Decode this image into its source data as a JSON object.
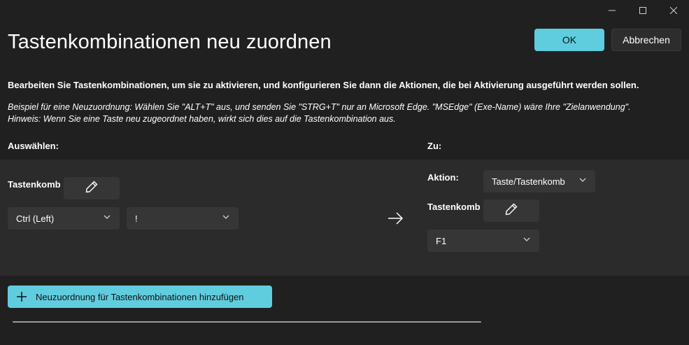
{
  "window": {
    "title": "Tastenkombinationen neu zuordnen",
    "controls": [
      "minimize-icon",
      "maximize-icon",
      "close-icon"
    ]
  },
  "header": {
    "ok_label": "OK",
    "cancel_label": "Abbrechen"
  },
  "description": "Bearbeiten Sie Tastenkombinationen, um sie zu aktivieren, und konfigurieren Sie dann die Aktionen, die bei Aktivierung ausgeführt werden sollen.",
  "example_line1": "Beispiel für eine Neuzuordnung: Wählen Sie \"ALT+T\" aus, und senden Sie \"STRG+T\" nur an Microsoft Edge. \"MSEdge\" (Exe-Name) wäre Ihre \"Zielanwendung\".",
  "example_line2": "Hinweis: Wenn Sie eine Taste neu zugeordnet haben, wirkt sich dies auf die Tastenkombination aus.",
  "select_label": "Auswählen:",
  "to_label": "Zu:",
  "source": {
    "shortcut_label": "Tastenkomb",
    "key1": "Ctrl (Left)",
    "key2": "!"
  },
  "target": {
    "action_label": "Aktion:",
    "action_value": "Taste/Tastenkomb",
    "shortcut_label": "Tastenkomb",
    "key1": "F1"
  },
  "add_button_label": "Neuzuordnung für Tastenkombinationen hinzufügen",
  "colors": {
    "accent": "#60cddf",
    "background": "#202020",
    "row_background": "#2b2b2b",
    "control_background": "#363636"
  }
}
